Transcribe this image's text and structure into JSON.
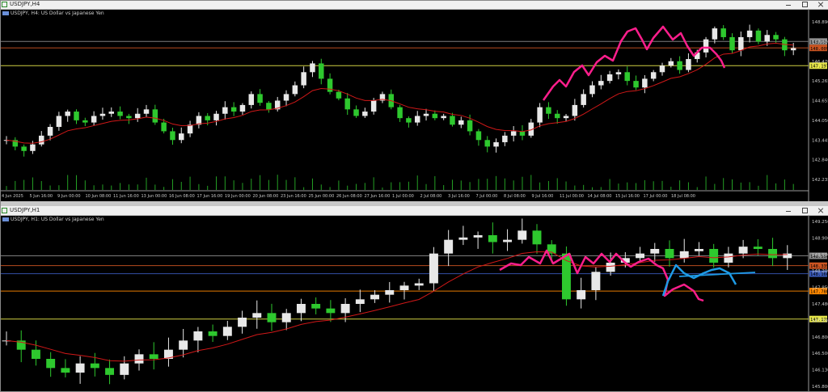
{
  "top": {
    "window_title": "USDJPY,H4",
    "symbol_line": "USDJPY, H4: US Dollar vs Japanese Yen",
    "price_ticks": [
      "148.890",
      "147.600",
      "146.470",
      "145.265",
      "144.655",
      "144.050",
      "143.445",
      "142.840",
      "142.235"
    ],
    "level_tags": [
      {
        "text": "148.304",
        "color": "#8a8a8a",
        "price": 148.304
      },
      {
        "text": "148.009",
        "color": "#cc5522",
        "price": 148.009
      },
      {
        "text": "147.197",
        "color": "#e6e64a",
        "price": 147.197
      }
    ],
    "time_labels": [
      "4 Jun 2025",
      "5 Jun 16:00",
      "9 Jun 00:00",
      "10 Jun 08:00",
      "11 Jun 16:00",
      "13 Jun 00:00",
      "16 Jun 08:00",
      "17 Jun 16:00",
      "19 Jun 00:00",
      "20 Jun 08:00",
      "23 Jun 16:00",
      "25 Jun 00:00",
      "26 Jun 08:00",
      "27 Jun 16:00",
      "1 Jul 00:00",
      "2 Jul 08:00",
      "3 Jul 16:00",
      "7 Jul 00:00",
      "8 Jul 08:00",
      "9 Jul 16:00",
      "11 Jul 00:00",
      "14 Jul 08:00",
      "15 Jul 16:00",
      "17 Jul 00:00",
      "18 Jul 08:00"
    ]
  },
  "bottom": {
    "window_title": "USDJPY,H1",
    "symbol_line": "USDJPY, H1: US Dollar vs Japanese Yen",
    "price_ticks": [
      "149.250",
      "148.900",
      "148.600",
      "148.200",
      "147.850",
      "147.480",
      "147.130",
      "146.800",
      "146.500",
      "146.130",
      "145.800"
    ],
    "level_tags": [
      {
        "text": "148.550",
        "color": "#8a8a8a",
        "price": 148.55
      },
      {
        "text": "148.335",
        "color": "#cc5522",
        "price": 148.335
      },
      {
        "text": "148.160",
        "color": "#3a5ab8",
        "price": 148.16
      },
      {
        "text": "147.780",
        "color": "#ff8800",
        "price": 147.78
      },
      {
        "text": "147.170",
        "color": "#e6e64a",
        "price": 147.17
      }
    ]
  },
  "colors": {
    "bull": "#e8e8e8",
    "bear": "#2ec82e",
    "ma": "#d01818",
    "pink": "#ff1e8c",
    "blue": "#1e9be6"
  },
  "chart_data": [
    {
      "type": "line",
      "title": "USDJPY, H4: US Dollar vs Japanese Yen",
      "series": [
        {
          "name": "USDJPY",
          "values": [
            143.8,
            143.5,
            143.3,
            143.6,
            144.0,
            144.4,
            144.9,
            145.1,
            144.7,
            144.6,
            144.9,
            145.0,
            145.1,
            144.9,
            144.8,
            145.0,
            145.2,
            144.6,
            144.2,
            143.8,
            144.1,
            144.5,
            144.9,
            144.7,
            145.0,
            145.3,
            145.1,
            145.4,
            145.9,
            145.5,
            145.2,
            145.6,
            145.9,
            146.3,
            146.9,
            147.3,
            146.6,
            146.0,
            145.7,
            145.2,
            144.9,
            145.1,
            145.6,
            145.9,
            145.3,
            144.8,
            144.6,
            144.9,
            145.0,
            144.8,
            144.9,
            144.5,
            144.7,
            144.2,
            143.8,
            143.5,
            143.7,
            144.0,
            144.2,
            144.0,
            144.6,
            145.3,
            145.0,
            144.8,
            144.9,
            145.4,
            145.9,
            146.3,
            146.5,
            146.8,
            146.9,
            146.5,
            146.2,
            146.6,
            146.9,
            147.2,
            147.4,
            147.0,
            147.5,
            147.8,
            148.4,
            148.9,
            148.5,
            147.9,
            148.5,
            148.8,
            148.3,
            148.6,
            148.4,
            147.9,
            148.0
          ]
        }
      ],
      "ylim": [
        142.0,
        149.2
      ]
    },
    {
      "type": "line",
      "title": "USDJPY, H1: US Dollar vs Japanese Yen",
      "series": [
        {
          "name": "USDJPY",
          "values": [
            146.7,
            146.5,
            146.3,
            146.1,
            146.0,
            146.2,
            146.1,
            145.95,
            146.2,
            146.4,
            146.3,
            146.5,
            146.7,
            146.9,
            146.8,
            147.0,
            147.2,
            147.3,
            147.1,
            147.3,
            147.5,
            147.4,
            147.3,
            147.5,
            147.6,
            147.7,
            147.8,
            147.9,
            147.95,
            148.6,
            148.9,
            148.95,
            149.0,
            148.85,
            148.9,
            149.1,
            148.8,
            148.6,
            147.6,
            147.8,
            148.2,
            148.4,
            148.5,
            148.6,
            148.7,
            148.5,
            148.65,
            148.7,
            148.4,
            148.6,
            148.75,
            148.7,
            148.5,
            148.6
          ]
        }
      ],
      "ylim": [
        145.7,
        149.3
      ]
    }
  ]
}
